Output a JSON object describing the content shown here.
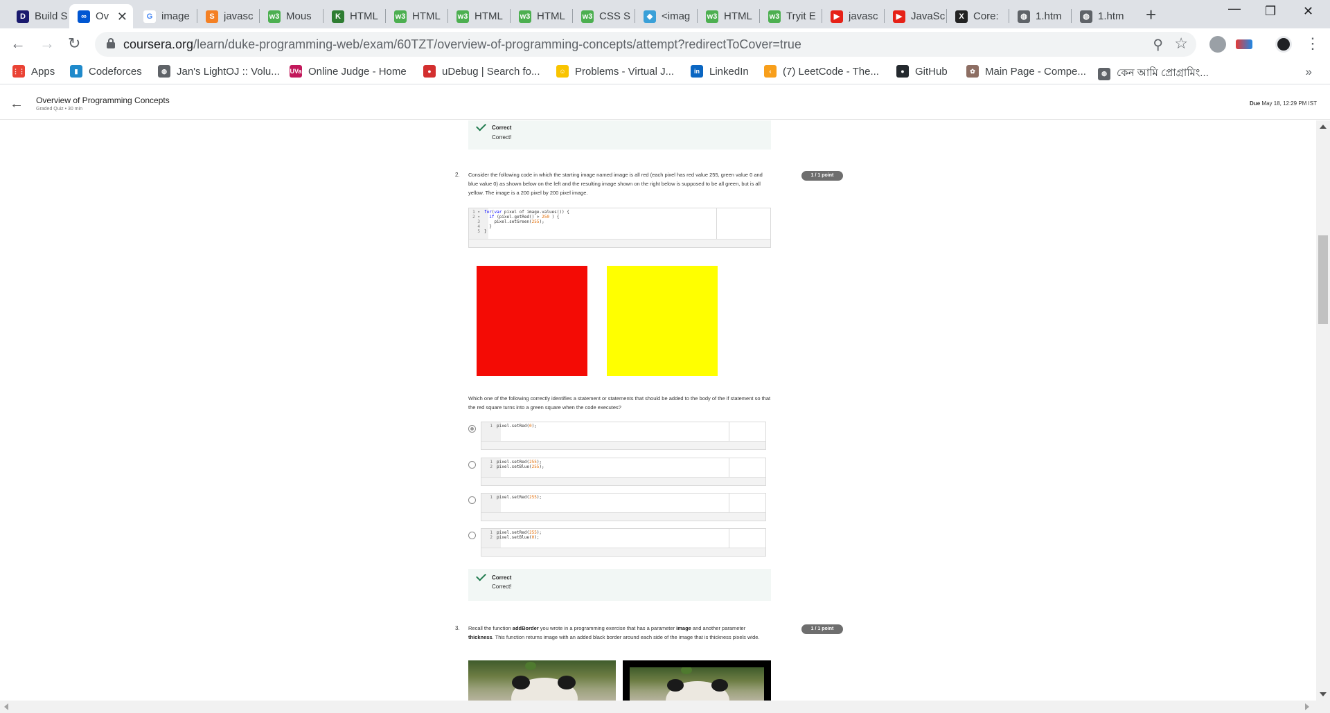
{
  "tabs": [
    {
      "label": "Build S",
      "fav_color": "#1a1a6e",
      "fav_text": "D"
    },
    {
      "label": "Ov",
      "fav_color": "#0056d2",
      "fav_text": "∞",
      "active": true
    },
    {
      "label": "image",
      "fav_color": "#ffffff",
      "fav_text": "G"
    },
    {
      "label": "javasc",
      "fav_color": "#f48024",
      "fav_text": "S"
    },
    {
      "label": "Mous",
      "fav_color": "#4caf50",
      "fav_text": "w3"
    },
    {
      "label": "HTML",
      "fav_color": "#2e7d32",
      "fav_text": "K"
    },
    {
      "label": "HTML",
      "fav_color": "#4caf50",
      "fav_text": "w3"
    },
    {
      "label": "HTML",
      "fav_color": "#4caf50",
      "fav_text": "w3"
    },
    {
      "label": "HTML",
      "fav_color": "#4caf50",
      "fav_text": "w3"
    },
    {
      "label": "CSS S",
      "fav_color": "#4caf50",
      "fav_text": "w3"
    },
    {
      "label": "<imag",
      "fav_color": "#3aa0d8",
      "fav_text": "◆"
    },
    {
      "label": "HTML",
      "fav_color": "#4caf50",
      "fav_text": "w3"
    },
    {
      "label": "Tryit E",
      "fav_color": "#4caf50",
      "fav_text": "w3"
    },
    {
      "label": "javasc",
      "fav_color": "#e62117",
      "fav_text": "▶"
    },
    {
      "label": "JavaSc",
      "fav_color": "#e62117",
      "fav_text": "▶"
    },
    {
      "label": "Core:",
      "fav_color": "#222222",
      "fav_text": "X"
    },
    {
      "label": "1.htm",
      "fav_color": "#5f6368",
      "fav_text": "◍"
    },
    {
      "label": "1.htm",
      "fav_color": "#5f6368",
      "fav_text": "◍"
    }
  ],
  "toolbar": {
    "url_host": "coursera.org",
    "url_path": "/learn/duke-programming-web/exam/60TZT/overview-of-programming-concepts/attempt?redirectToCover=true"
  },
  "bookmarks": [
    {
      "label": "Apps",
      "icon_color": "#ea4335",
      "icon_text": "⋮⋮"
    },
    {
      "label": "Codeforces",
      "icon_color": "#1f8acb",
      "icon_text": "▮"
    },
    {
      "label": "Jan's LightOJ :: Volu...",
      "icon_color": "#5f6368",
      "icon_text": "◍"
    },
    {
      "label": "Online Judge - Home",
      "icon_color": "#c2185b",
      "icon_text": "UVa"
    },
    {
      "label": "uDebug | Search fo...",
      "icon_color": "#d32f2f",
      "icon_text": "●"
    },
    {
      "label": "Problems - Virtual J...",
      "icon_color": "#f9c400",
      "icon_text": "☺"
    },
    {
      "label": "LinkedIn",
      "icon_color": "#0a66c2",
      "icon_text": "in"
    },
    {
      "label": "(7) LeetCode - The...",
      "icon_color": "#f89f1b",
      "icon_text": "‹"
    },
    {
      "label": "GitHub",
      "icon_color": "#24292e",
      "icon_text": "●"
    },
    {
      "label": "Main Page - Compe...",
      "icon_color": "#8d6e63",
      "icon_text": "✿"
    },
    {
      "label": "কেন আমি প্রোগ্রামিং...",
      "icon_color": "#5f6368",
      "icon_text": "◍"
    }
  ],
  "bookmarks_more": "»",
  "course": {
    "title": "Overview of Programming Concepts",
    "subtitle": "Graded Quiz • 30 min",
    "due_label": "Due",
    "due_value": "May 18, 12:29 PM IST"
  },
  "feedback_top": {
    "label": "Correct",
    "message": "Correct!"
  },
  "q2": {
    "number": "2.",
    "points": "1 / 1 point",
    "text": "Consider the following code in which the starting image named image is all red (each pixel has red value 255, green value 0 and blue value 0) as shown below on the left and the resulting image shown on the right below is supposed to be all green, but is all yellow. The image is a 200 pixel by 200 pixel image.",
    "code": [
      {
        "n": "1 ▾",
        "parts": [
          [
            "kw",
            "for"
          ],
          [
            "",
            "("
          ],
          [
            "kw",
            "var"
          ],
          [
            "",
            " pixel of image.values()) {"
          ]
        ]
      },
      {
        "n": "2 ▾",
        "parts": [
          [
            "",
            "  "
          ],
          [
            "kw",
            "if"
          ],
          [
            "",
            " (pixel.getRed() > "
          ],
          [
            "num",
            "250"
          ],
          [
            "",
            " ) {"
          ]
        ]
      },
      {
        "n": "3",
        "parts": [
          [
            "",
            "    pixel.setGreen("
          ],
          [
            "num",
            "255"
          ],
          [
            "",
            ");"
          ]
        ]
      },
      {
        "n": "4",
        "parts": [
          [
            "",
            "  }"
          ]
        ]
      },
      {
        "n": "5",
        "parts": [
          [
            "",
            "}"
          ]
        ]
      }
    ],
    "left_square_color": "#f40b05",
    "right_square_color": "#ffff00",
    "prompt": "Which one of the following correctly identifies a statement or statements that should be added to the body of the if statement so that the red square turns into a green square when the code executes?",
    "options": [
      {
        "lines": [
          {
            "n": "1",
            "parts": [
              [
                "",
                "pixel.setRed("
              ],
              [
                "num",
                "0"
              ],
              [
                "",
                ");"
              ]
            ]
          }
        ],
        "selected": true
      },
      {
        "lines": [
          {
            "n": "1",
            "parts": [
              [
                "",
                "pixel.setRed("
              ],
              [
                "num",
                "255"
              ],
              [
                "",
                ");"
              ]
            ]
          },
          {
            "n": "2",
            "parts": [
              [
                "",
                "pixel.setBlue("
              ],
              [
                "num",
                "255"
              ],
              [
                "",
                ");"
              ]
            ]
          }
        ],
        "selected": false
      },
      {
        "lines": [
          {
            "n": "1",
            "parts": [
              [
                "",
                "pixel.setRed("
              ],
              [
                "num",
                "255"
              ],
              [
                "",
                ");"
              ]
            ]
          }
        ],
        "selected": false
      },
      {
        "lines": [
          {
            "n": "1",
            "parts": [
              [
                "",
                "pixel.setRed("
              ],
              [
                "num",
                "255"
              ],
              [
                "",
                ");"
              ]
            ]
          },
          {
            "n": "2",
            "parts": [
              [
                "",
                "pixel.setBlue("
              ],
              [
                "num",
                "0"
              ],
              [
                "",
                ");"
              ]
            ]
          }
        ],
        "selected": false
      }
    ],
    "feedback": {
      "label": "Correct",
      "message": "Correct!"
    }
  },
  "q3": {
    "number": "3.",
    "points": "1 / 1 point",
    "text_parts": [
      [
        "",
        "Recall the function "
      ],
      [
        "b",
        "addBorder"
      ],
      [
        "",
        " you wrote in a programming exercise that has a parameter "
      ],
      [
        "b",
        "image"
      ],
      [
        "",
        " and another parameter "
      ],
      [
        "b",
        "thickness"
      ],
      [
        "",
        ". This function returns image with an added black border around each side of the image that is thickness pixels wide."
      ]
    ]
  }
}
